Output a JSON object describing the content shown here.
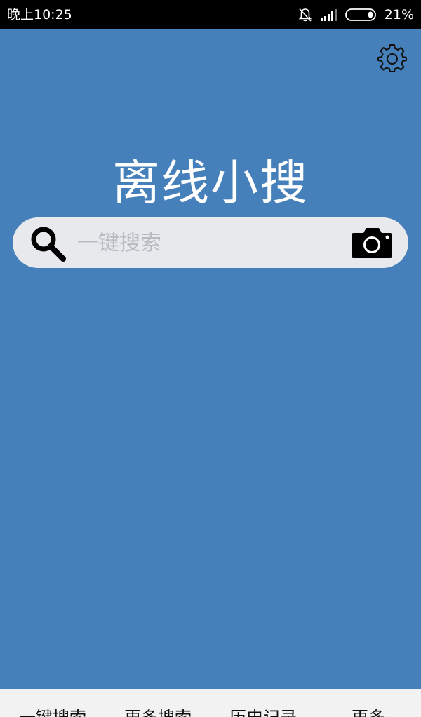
{
  "status_bar": {
    "time": "晚上10:25",
    "battery_percent": "21%",
    "icons": [
      "bell-muted-icon",
      "signal-icon",
      "battery-icon"
    ]
  },
  "header": {
    "settings_icon": "gear-icon"
  },
  "main": {
    "title": "离线小搜"
  },
  "search": {
    "placeholder": "一键搜索",
    "value": "",
    "search_icon": "search-icon",
    "camera_icon": "camera-icon"
  },
  "bottom_nav": {
    "items": [
      {
        "label": "一键搜索"
      },
      {
        "label": "更多搜索"
      },
      {
        "label": "历史记录"
      },
      {
        "label": "更多"
      }
    ]
  },
  "colors": {
    "background": "#4680BA",
    "status_bar": "#000000",
    "search_box": "#E7E9EC",
    "bottom_nav": "#F2F2F2"
  }
}
